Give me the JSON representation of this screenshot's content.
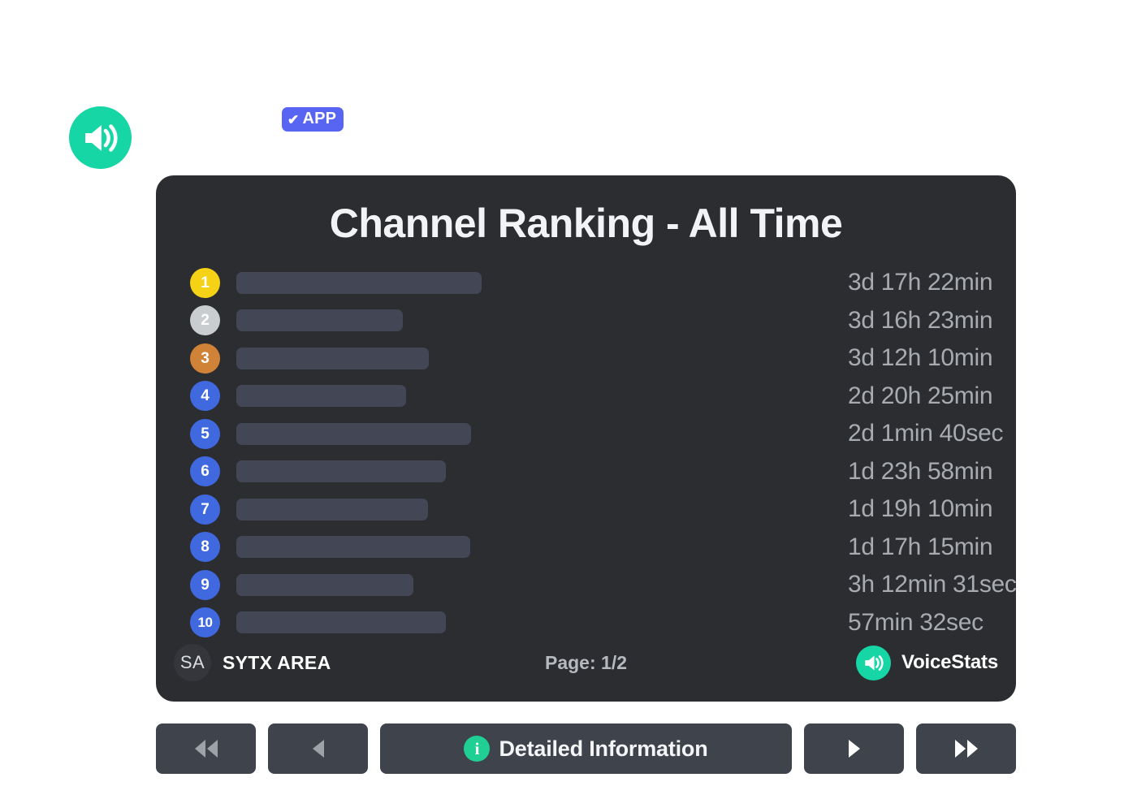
{
  "bot": {
    "avatar_icon": "speaker-icon",
    "badge": {
      "check_glyph": "✔",
      "label": "APP"
    }
  },
  "card": {
    "title": "Channel Ranking - All Time",
    "background_color": "#2b2d31",
    "rows": [
      {
        "rank": "1",
        "badge_color": "#f5d216",
        "badge_style": "gold",
        "name_redacted": true,
        "name_bar_width": 302,
        "time": "3d 17h 22min"
      },
      {
        "rank": "2",
        "badge_color": "#cacdd0",
        "badge_style": "silver",
        "name_redacted": true,
        "name_bar_width": 205,
        "time": "3d 16h 23min"
      },
      {
        "rank": "3",
        "badge_color": "#d08236",
        "badge_style": "bronze",
        "name_redacted": true,
        "name_bar_width": 237,
        "time": "3d 12h 10min"
      },
      {
        "rank": "4",
        "badge_color": "#4069e0",
        "badge_style": "blue",
        "name_redacted": true,
        "name_bar_width": 209,
        "time": "2d 20h 25min"
      },
      {
        "rank": "5",
        "badge_color": "#4069e0",
        "badge_style": "blue",
        "name_redacted": true,
        "name_bar_width": 289,
        "time": "2d 1min 40sec"
      },
      {
        "rank": "6",
        "badge_color": "#4069e0",
        "badge_style": "blue",
        "name_redacted": true,
        "name_bar_width": 258,
        "time": "1d 23h 58min"
      },
      {
        "rank": "7",
        "badge_color": "#4069e0",
        "badge_style": "blue",
        "name_redacted": true,
        "name_bar_width": 236,
        "time": "1d 19h 10min"
      },
      {
        "rank": "8",
        "badge_color": "#4069e0",
        "badge_style": "blue",
        "name_redacted": true,
        "name_bar_width": 288,
        "time": "1d 17h 15min"
      },
      {
        "rank": "9",
        "badge_color": "#4069e0",
        "badge_style": "blue",
        "name_redacted": true,
        "name_bar_width": 218,
        "time": "3h 12min 31sec"
      },
      {
        "rank": "10",
        "badge_color": "#4069e0",
        "badge_style": "blue",
        "name_redacted": true,
        "name_bar_width": 258,
        "time": "57min 32sec"
      }
    ],
    "footer": {
      "server_initials": "SA",
      "server_name": "SYTX AREA",
      "page_indicator": "Page: 1/2",
      "brand_icon": "speaker-icon",
      "brand_name": "VoiceStats"
    }
  },
  "buttons": {
    "first": {
      "name": "first-page-button",
      "glyph": "◀◀",
      "enabled": false
    },
    "previous": {
      "name": "previous-page-button",
      "glyph": "◀",
      "enabled": false
    },
    "detail": {
      "name": "detailed-information-button",
      "icon": "info-icon",
      "icon_glyph": "i",
      "label": "Detailed Information",
      "enabled": true
    },
    "next": {
      "name": "next-page-button",
      "glyph": "▶",
      "enabled": true
    },
    "last": {
      "name": "last-page-button",
      "glyph": "▶▶",
      "enabled": true
    }
  },
  "colors": {
    "page_background": "#ffffff",
    "card_background": "#2b2d31",
    "accent_green": "#17d6a5",
    "accent_blurple": "#5865f2",
    "name_bar": "#434755",
    "time_text": "#a8abb0",
    "button_background": "#3f434c",
    "arrow_disabled": "#9da1a8",
    "arrow_enabled": "#ffffff"
  }
}
